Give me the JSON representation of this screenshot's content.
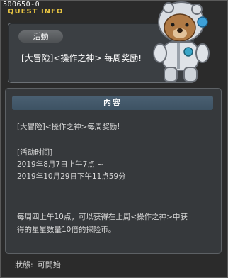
{
  "header": {
    "quest_id": "500650-0",
    "title": "QUEST INFO"
  },
  "event": {
    "tag": "活動",
    "title": "[大冒险]<操作之神> 每周奖励!"
  },
  "content": {
    "heading": "內容",
    "lines": [
      "[大冒险]<操作之神>每周奖励!",
      "[活动时间]",
      "2019年8月7日上午7点 ~",
      "2019年10月29日下午11点59分",
      "每周四上午10点，可以获得在上周<操作之神>中获",
      "得的星星数量10倍的探险币。"
    ]
  },
  "status": {
    "label": "狀態:",
    "value": "可開始"
  },
  "colors": {
    "title_accent": "#e8c542",
    "section_head": "#4a6072"
  },
  "icons": [
    "bear-character-icon"
  ]
}
